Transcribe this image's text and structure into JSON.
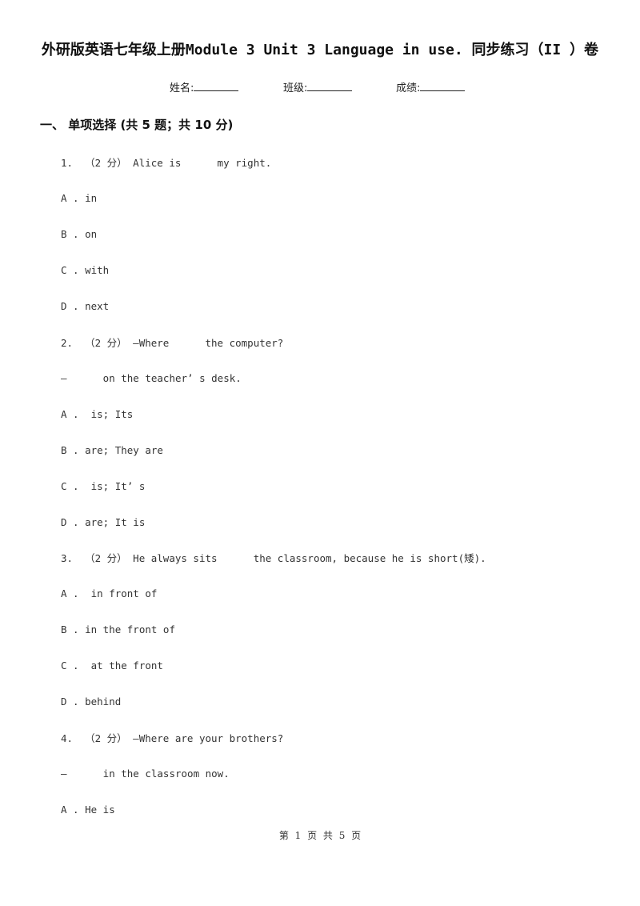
{
  "title": "外研版英语七年级上册Module 3 Unit 3 Language in use. 同步练习（II ）卷",
  "info": {
    "name_label": "姓名:",
    "class_label": "班级:",
    "score_label": "成绩:"
  },
  "section": {
    "heading": "一、  单项选择 (共 5 题；共 10 分)"
  },
  "questions": [
    {
      "stem": "1.  （2 分） Alice is      my right.",
      "options": [
        "A . in",
        "B . on",
        "C . with",
        "D . next"
      ]
    },
    {
      "stem": "2.  （2 分） —Where      the computer?",
      "stem2": "—      on the teacher’ s desk.",
      "options": [
        "A .  is; Its",
        "B . are; They are",
        "C .  is; It’ s",
        "D . are; It is"
      ]
    },
    {
      "stem": "3.  （2 分） He always sits      the classroom, because he is short(矮).",
      "options": [
        "A .  in front of",
        "B . in the front of",
        "C .  at the front",
        "D . behind"
      ]
    },
    {
      "stem": "4.  （2 分） —Where are your brothers?",
      "stem2": "—      in the classroom now.",
      "options": [
        "A . He is"
      ]
    }
  ],
  "footer": "第 1 页 共 5 页"
}
